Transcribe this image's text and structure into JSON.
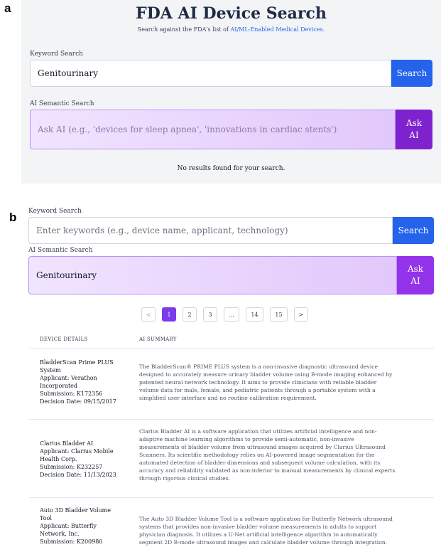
{
  "panel_labels": {
    "a": "a",
    "b": "b"
  },
  "panel_a": {
    "title": "FDA AI Device Search",
    "subtitle_prefix": "Search against the FDA's list of",
    "subtitle_link": "AI/ML-Enabled Medical Devices.",
    "keyword_label": "Keyword Search",
    "keyword_value": "Genitourinary",
    "search_button": "Search",
    "ai_label": "AI Semantic Search",
    "ai_placeholder": "Ask AI (e.g., 'devices for sleep apnea', 'innovations in cardiac stents')",
    "ask_button_line1": "Ask",
    "ask_button_line2": "AI",
    "no_results": "No results found for your search."
  },
  "panel_b": {
    "keyword_label": "Keyword Search",
    "keyword_placeholder": "Enter keywords (e.g., device name, applicant, technology)",
    "search_button": "Search",
    "ai_label": "AI Semantic Search",
    "ai_value": "Genitourinary",
    "ask_button_line1": "Ask",
    "ask_button_line2": "AI",
    "pagination": {
      "prev": "<",
      "pages": [
        "1",
        "2",
        "3",
        "...",
        "14",
        "15"
      ],
      "active": "1",
      "next": ">"
    },
    "table": {
      "headers": [
        "DEVICE DETAILS",
        "AI SUMMARY"
      ],
      "rows": [
        {
          "details": [
            "BladderScan Prime PLUS",
            "System",
            "Applicant: Verathon",
            "Incorporated",
            "Submission: K172356",
            "Decision Date: 09/15/2017"
          ],
          "summary": [
            "The BladderScan® PRIME PLUS system is a non-invasive diagnostic ultrasound device",
            "designed to accurately measure urinary bladder volume using B-mode imaging enhanced by",
            "patented neural network technology. It aims to provide clinicians with reliable bladder",
            "volume data for male, female, and pediatric patients through a portable system with a",
            "simplified user interface and no routine calibration requirement."
          ]
        },
        {
          "details": [
            "Clarius Bladder AI",
            "Applicant: Clarius Mobile",
            "Health Corp.",
            "Submission: K232257",
            "Decision Date: 11/13/2023"
          ],
          "summary": [
            "Clarius Bladder AI is a software application that utilizes artificial intelligence and non-",
            "adaptive machine learning algorithms to provide semi-automatic, non-invasive",
            "measurements of bladder volume from ultrasound images acquired by Clarius Ultrasound",
            "Scanners. Its scientific methodology relies on AI-powered image segmentation for the",
            "automated detection of bladder dimensions and subsequent volume calculation, with its",
            "accuracy and reliability validated as non-inferior to manual measurements by clinical experts",
            "through rigorous clinical studies."
          ]
        },
        {
          "details": [
            "Auto 3D Bladder Volume",
            "Tool",
            "Applicant: Butterfly",
            "Network, Inc.",
            "Submission: K200980"
          ],
          "summary": [
            "The Auto 3D Bladder Volume Tool is a software application for Butterfly Network ultrasound",
            "systems that provides non-invasive bladder volume measurements in adults to support",
            "physician diagnosis. It utilizes a U-Net artificial intelligence algorithm to automatically",
            "segment 2D B-mode ultrasound images and calculate bladder volume through integration."
          ]
        }
      ]
    }
  }
}
